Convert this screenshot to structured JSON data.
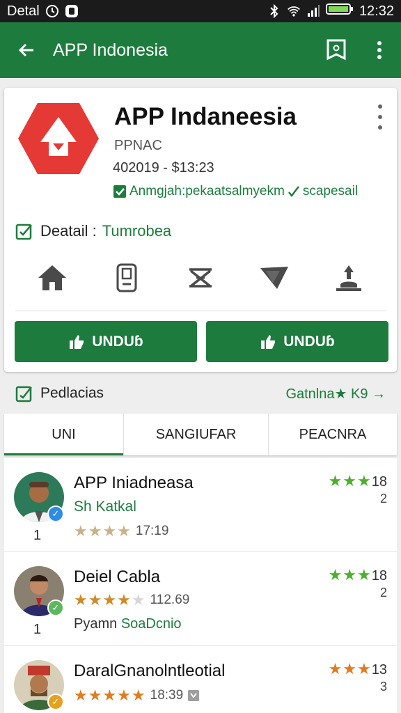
{
  "status": {
    "left_text": "Detal",
    "time": "12:32"
  },
  "appbar": {
    "title": "APP Indonesia"
  },
  "app": {
    "name": "APP Indaneesia",
    "developer": "PPNAC",
    "meta": "402019 - $13:23",
    "verified": "Anmgjah:pekaatsalmyekm",
    "verified_tag": "scapesail",
    "detail_label": "Deatail :",
    "detail_value": "Tumrobea"
  },
  "categories": [
    {
      "icon": "home-icon"
    },
    {
      "icon": "phone-icon"
    },
    {
      "icon": "crossed-tool-icon"
    },
    {
      "icon": "shield-icon"
    },
    {
      "icon": "download-person-icon"
    }
  ],
  "buttons": {
    "primary": "UNDUɓ",
    "secondary": "UNDUɓ"
  },
  "section": {
    "title": "Pedlacias",
    "see_more": "Gatnlna★ K9 →"
  },
  "tabs": [
    "UNI",
    "SANGIUFAR",
    "PEACNRA"
  ],
  "reviews": [
    {
      "rank": "1",
      "name": "APP Iniadneasa",
      "sub": "Sh Katkal",
      "stars_text": "17:19",
      "score": "18",
      "count": "2",
      "badge_color": "#2e8be6"
    },
    {
      "rank": "1",
      "name": "Deiel Cabla",
      "sub": "Pyamn",
      "sub_green": "SoaDcnio",
      "stars_text": "112.69",
      "score": "18",
      "count": "2",
      "badge_color": "#5cb85c"
    },
    {
      "name": "DaralGnanolntleotial",
      "stars_text": "18:39",
      "score": "13",
      "count": "3",
      "badge_color": "#e6a21e"
    }
  ],
  "colors": {
    "primary": "#1e7b3e",
    "logo_red": "#e53935",
    "star_green": "#4caf2e",
    "star_orange": "#e07b20"
  }
}
